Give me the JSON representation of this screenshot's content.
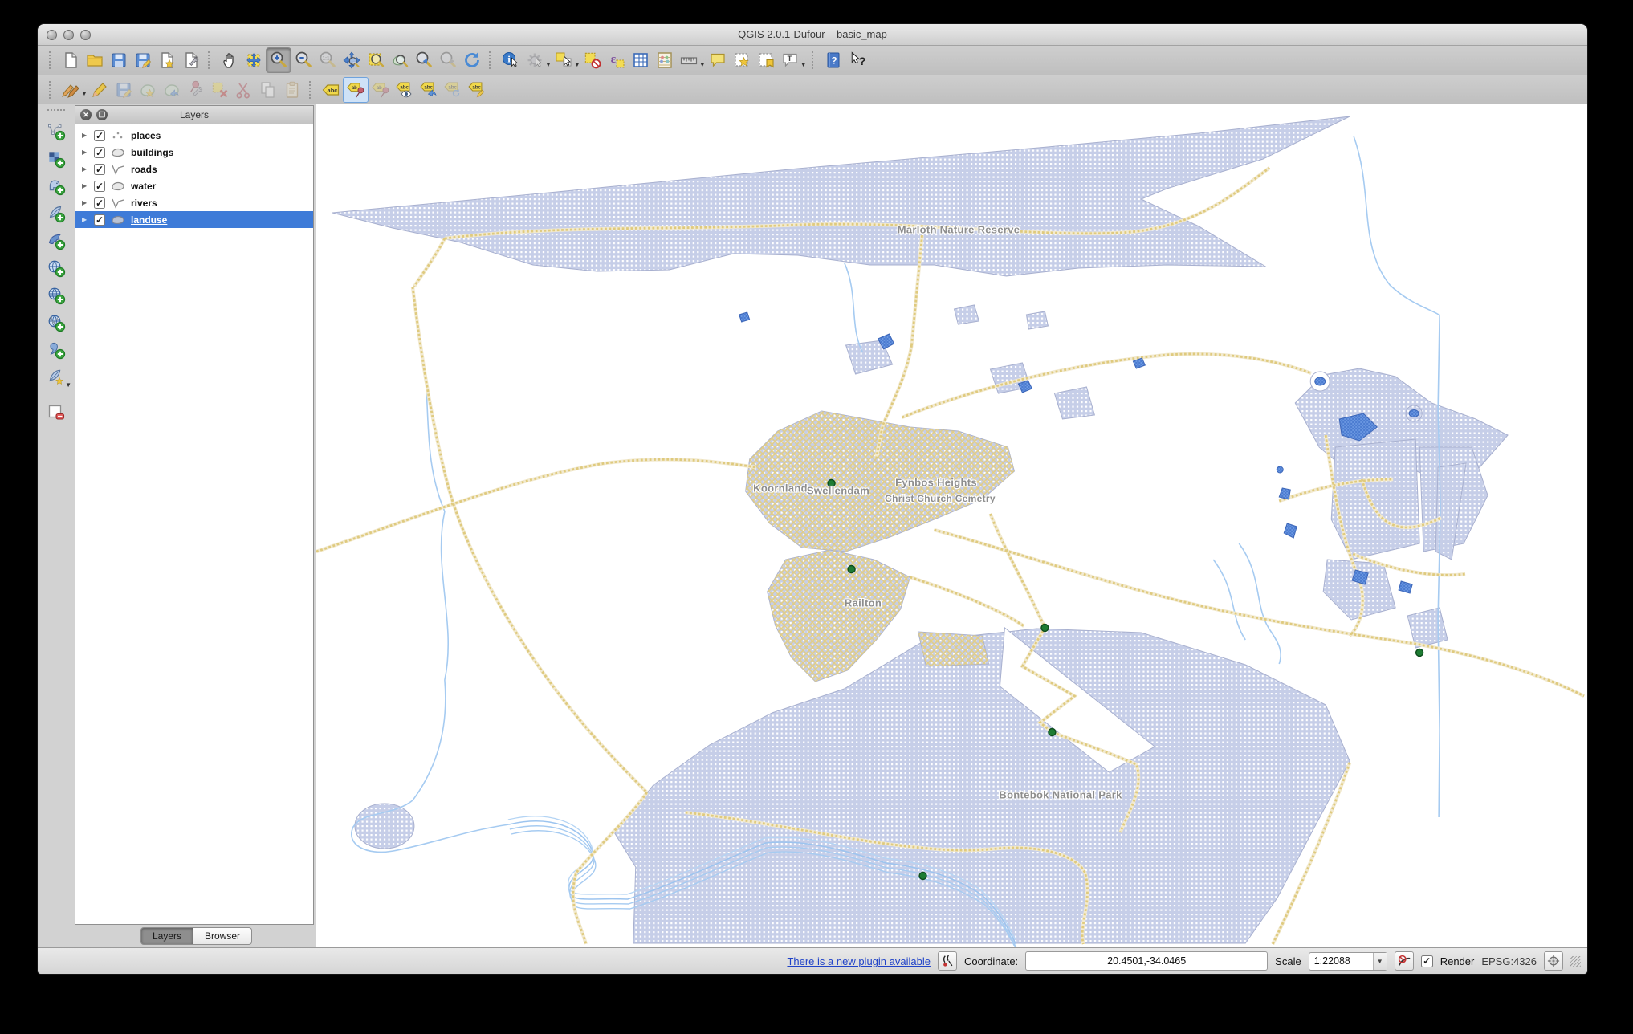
{
  "window": {
    "title": "QGIS 2.0.1-Dufour – basic_map",
    "controls": [
      "close-window",
      "minimize-window",
      "zoom-window"
    ]
  },
  "toolbars": {
    "file": [
      "new-project",
      "open-project",
      "save-project",
      "save-project-as",
      "new-print-composer",
      "composer-manager"
    ],
    "navigation": [
      "pan-map",
      "pan-to-selection",
      "zoom-in",
      "zoom-out",
      "zoom-actual-size",
      "zoom-full-extent",
      "zoom-to-selection",
      "zoom-to-layer",
      "zoom-last",
      "zoom-next",
      "refresh-map"
    ],
    "attributes": [
      "identify-features",
      "run-feature-action",
      "select-features",
      "deselect-features",
      "select-by-expression",
      "open-attribute-table",
      "field-calculator",
      "measure-line",
      "map-tips",
      "new-bookmark",
      "show-bookmarks",
      "text-annotation"
    ],
    "help": [
      "help-contents",
      "whats-this"
    ],
    "digitizing": [
      "current-edits",
      "toggle-editing",
      "save-layer-edits",
      "add-feature",
      "move-feature",
      "node-tool",
      "delete-selected",
      "cut-features",
      "copy-features",
      "paste-features"
    ],
    "labeling": [
      "layer-labeling-options",
      "pin-unpin-labels",
      "highlight-pinned-labels",
      "show-hide-labels",
      "move-label",
      "rotate-label",
      "change-label"
    ],
    "manage_layers": [
      "add-vector-layer",
      "add-raster-layer",
      "add-postgis-layer",
      "add-spatialite-layer",
      "add-mssql-layer",
      "add-wms-layer",
      "add-wcs-layer",
      "add-wfs-layer",
      "add-delimited-text-layer",
      "new-shapefile-layer",
      "remove-layer"
    ]
  },
  "layers_panel": {
    "title": "Layers",
    "layers": [
      {
        "label": "places",
        "checked": true,
        "type": "point",
        "selected": false
      },
      {
        "label": "buildings",
        "checked": true,
        "type": "polygon",
        "selected": false
      },
      {
        "label": "roads",
        "checked": true,
        "type": "line",
        "selected": false
      },
      {
        "label": "water",
        "checked": true,
        "type": "polygon",
        "selected": false
      },
      {
        "label": "rivers",
        "checked": true,
        "type": "line",
        "selected": false
      },
      {
        "label": "landuse",
        "checked": true,
        "type": "polygon",
        "selected": true
      }
    ],
    "tabs": [
      {
        "label": "Layers",
        "active": true
      },
      {
        "label": "Browser",
        "active": false
      }
    ]
  },
  "map": {
    "labels": [
      {
        "text": "Marloth Nature Reserve"
      },
      {
        "text": "Koornland"
      },
      {
        "text": "Swellendam"
      },
      {
        "text": "Fynbos Heights"
      },
      {
        "text": "Christ Church Cemetry"
      },
      {
        "text": "Railton"
      },
      {
        "text": "Bontebok National Park"
      }
    ],
    "place_points": 6
  },
  "statusbar": {
    "plugin_link": "There is a new plugin available",
    "coordinate_label": "Coordinate:",
    "coordinate_value": "20.4501,-34.0465",
    "scale_label": "Scale",
    "scale_value": "1:22088",
    "render_label": "Render",
    "render_checked": true,
    "crs": "EPSG:4326"
  },
  "colors": {
    "selection_blue": "#3e7bd8",
    "landuse_fill": "#c8d0e9",
    "water_fill": "#6d9ae3",
    "road_yellow": "#dfca7e",
    "river_blue": "#a6cbf1",
    "place_green": "#1e7c33",
    "label_gray": "#8d8d8d"
  }
}
